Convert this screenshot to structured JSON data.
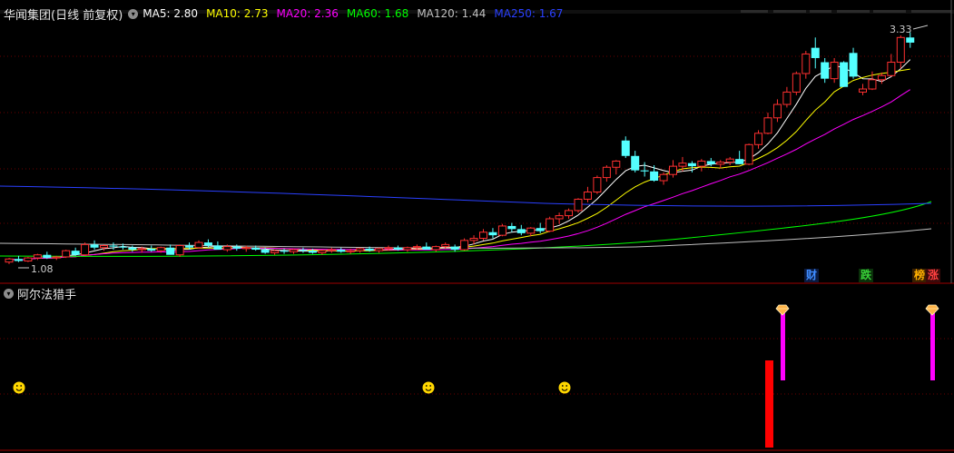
{
  "header": {
    "title": "华闻集团(日线 前复权)",
    "collapse_icon": "chevron-down-icon",
    "ma": [
      {
        "label": "MA5:",
        "value": "2.80",
        "color": "#ffffff"
      },
      {
        "label": "MA10:",
        "value": "2.73",
        "color": "#ffff00"
      },
      {
        "label": "MA20:",
        "value": "2.36",
        "color": "#ff00ff"
      },
      {
        "label": "MA60:",
        "value": "1.68",
        "color": "#00ff00"
      },
      {
        "label": "MA120:",
        "value": "1.44",
        "color": "#c0c0c0"
      },
      {
        "label": "MA250:",
        "value": "1.67",
        "color": "#2a40ff"
      }
    ]
  },
  "price_chart": {
    "high_label": "3.33",
    "low_label": "1.08",
    "colors": {
      "up": "#ff3030",
      "down": "#54ffff",
      "grid": "#6a0000",
      "border": "#a00000"
    },
    "ylim": [
      1.0,
      3.45
    ],
    "candles": [
      [
        1.1,
        1.14,
        1.08,
        1.13
      ],
      [
        1.13,
        1.16,
        1.1,
        1.11
      ],
      [
        1.11,
        1.15,
        1.1,
        1.14
      ],
      [
        1.14,
        1.18,
        1.12,
        1.17
      ],
      [
        1.17,
        1.2,
        1.13,
        1.14
      ],
      [
        1.14,
        1.16,
        1.12,
        1.15
      ],
      [
        1.15,
        1.22,
        1.14,
        1.21
      ],
      [
        1.21,
        1.24,
        1.16,
        1.17
      ],
      [
        1.17,
        1.29,
        1.16,
        1.27
      ],
      [
        1.27,
        1.31,
        1.22,
        1.24
      ],
      [
        1.24,
        1.27,
        1.21,
        1.26
      ],
      [
        1.26,
        1.29,
        1.22,
        1.25
      ],
      [
        1.25,
        1.28,
        1.22,
        1.24
      ],
      [
        1.24,
        1.26,
        1.2,
        1.22
      ],
      [
        1.22,
        1.25,
        1.19,
        1.23
      ],
      [
        1.23,
        1.26,
        1.2,
        1.21
      ],
      [
        1.21,
        1.25,
        1.19,
        1.24
      ],
      [
        1.24,
        1.27,
        1.2,
        1.17
      ],
      [
        1.17,
        1.27,
        1.15,
        1.26
      ],
      [
        1.26,
        1.29,
        1.22,
        1.24
      ],
      [
        1.24,
        1.31,
        1.23,
        1.29
      ],
      [
        1.29,
        1.32,
        1.24,
        1.26
      ],
      [
        1.26,
        1.3,
        1.23,
        1.22
      ],
      [
        1.22,
        1.27,
        1.2,
        1.25
      ],
      [
        1.25,
        1.27,
        1.21,
        1.23
      ],
      [
        1.23,
        1.26,
        1.2,
        1.24
      ],
      [
        1.24,
        1.26,
        1.21,
        1.22
      ],
      [
        1.22,
        1.24,
        1.18,
        1.19
      ],
      [
        1.19,
        1.22,
        1.17,
        1.21
      ],
      [
        1.21,
        1.23,
        1.18,
        1.2
      ],
      [
        1.2,
        1.23,
        1.18,
        1.22
      ],
      [
        1.22,
        1.24,
        1.19,
        1.21
      ],
      [
        1.21,
        1.23,
        1.18,
        1.19
      ],
      [
        1.19,
        1.22,
        1.17,
        1.21
      ],
      [
        1.21,
        1.24,
        1.19,
        1.22
      ],
      [
        1.22,
        1.24,
        1.19,
        1.2
      ],
      [
        1.2,
        1.23,
        1.18,
        1.21
      ],
      [
        1.21,
        1.24,
        1.19,
        1.23
      ],
      [
        1.23,
        1.25,
        1.2,
        1.21
      ],
      [
        1.21,
        1.24,
        1.19,
        1.23
      ],
      [
        1.23,
        1.26,
        1.21,
        1.24
      ],
      [
        1.24,
        1.26,
        1.21,
        1.22
      ],
      [
        1.22,
        1.25,
        1.2,
        1.24
      ],
      [
        1.24,
        1.27,
        1.22,
        1.25
      ],
      [
        1.25,
        1.29,
        1.23,
        1.22
      ],
      [
        1.22,
        1.26,
        1.2,
        1.25
      ],
      [
        1.25,
        1.29,
        1.23,
        1.27
      ],
      [
        1.25,
        1.27,
        1.2,
        1.22
      ],
      [
        1.22,
        1.33,
        1.21,
        1.31
      ],
      [
        1.31,
        1.36,
        1.27,
        1.33
      ],
      [
        1.33,
        1.42,
        1.31,
        1.39
      ],
      [
        1.39,
        1.43,
        1.33,
        1.36
      ],
      [
        1.36,
        1.47,
        1.35,
        1.45
      ],
      [
        1.45,
        1.48,
        1.39,
        1.42
      ],
      [
        1.42,
        1.46,
        1.36,
        1.38
      ],
      [
        1.38,
        1.44,
        1.35,
        1.43
      ],
      [
        1.43,
        1.48,
        1.38,
        1.4
      ],
      [
        1.4,
        1.54,
        1.39,
        1.52
      ],
      [
        1.52,
        1.58,
        1.47,
        1.55
      ],
      [
        1.55,
        1.62,
        1.52,
        1.6
      ],
      [
        1.6,
        1.72,
        1.58,
        1.71
      ],
      [
        1.71,
        1.83,
        1.68,
        1.78
      ],
      [
        1.78,
        1.94,
        1.76,
        1.92
      ],
      [
        1.92,
        2.04,
        1.88,
        2.02
      ],
      [
        2.02,
        2.09,
        1.95,
        2.08
      ],
      [
        2.28,
        2.32,
        2.11,
        2.13
      ],
      [
        2.13,
        2.18,
        1.97,
        1.99
      ],
      [
        1.99,
        2.07,
        1.93,
        1.98
      ],
      [
        1.98,
        2.04,
        1.88,
        1.89
      ],
      [
        1.89,
        1.97,
        1.85,
        1.95
      ],
      [
        1.95,
        2.09,
        1.92,
        2.03
      ],
      [
        2.03,
        2.12,
        1.98,
        2.06
      ],
      [
        2.06,
        2.08,
        1.97,
        2.03
      ],
      [
        2.03,
        2.1,
        1.98,
        2.08
      ],
      [
        2.08,
        2.11,
        2.03,
        2.05
      ],
      [
        2.05,
        2.09,
        2.01,
        2.07
      ],
      [
        2.07,
        2.12,
        2.04,
        2.1
      ],
      [
        2.1,
        2.18,
        2.05,
        2.05
      ],
      [
        2.05,
        2.25,
        2.04,
        2.24
      ],
      [
        2.24,
        2.38,
        2.2,
        2.35
      ],
      [
        2.35,
        2.55,
        2.34,
        2.5
      ],
      [
        2.5,
        2.68,
        2.46,
        2.63
      ],
      [
        2.63,
        2.8,
        2.6,
        2.75
      ],
      [
        2.75,
        2.95,
        2.72,
        2.93
      ],
      [
        2.93,
        3.15,
        2.88,
        3.12
      ],
      [
        3.18,
        3.28,
        2.98,
        3.08
      ],
      [
        3.04,
        3.08,
        2.84,
        2.88
      ],
      [
        2.88,
        3.08,
        2.84,
        3.04
      ],
      [
        3.04,
        3.05,
        2.8,
        2.8
      ],
      [
        3.13,
        3.18,
        2.88,
        2.9
      ],
      [
        2.75,
        2.83,
        2.72,
        2.78
      ],
      [
        2.78,
        2.95,
        2.77,
        2.87
      ],
      [
        2.87,
        2.94,
        2.83,
        2.91
      ],
      [
        2.91,
        3.12,
        2.9,
        3.04
      ],
      [
        3.04,
        3.3,
        2.98,
        3.28
      ],
      [
        3.28,
        3.33,
        3.18,
        3.23
      ]
    ]
  },
  "badges": [
    {
      "text": "财",
      "color": "#3f8cff",
      "bg": "#0a1a40"
    },
    {
      "text": "跌",
      "color": "#38d038",
      "bg": "#0a300a"
    },
    {
      "text": "榜",
      "color": "#ffb000",
      "bg": "#3a2000"
    },
    {
      "text": "涨",
      "color": "#ff4040",
      "bg": "#3a0a0a"
    }
  ],
  "indicator": {
    "title": "阿尔法猎手",
    "collapse_icon": "chevron-down-icon",
    "smiley_icon": "smiley-icon",
    "diamond_icon": "diamond-icon",
    "colors": {
      "red_bar": "#ff0000",
      "magenta_bar": "#ff00ff",
      "smiley": "#ffd700"
    }
  }
}
